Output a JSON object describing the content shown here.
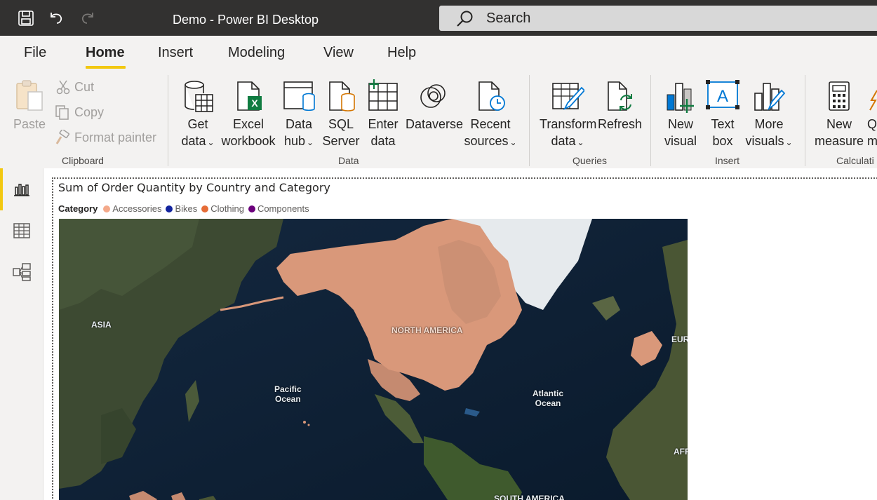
{
  "app": {
    "title": "Demo - Power BI Desktop"
  },
  "search": {
    "placeholder": "Search"
  },
  "tabs": [
    "File",
    "Home",
    "Insert",
    "Modeling",
    "View",
    "Help"
  ],
  "ribbon": {
    "clipboard": {
      "paste": "Paste",
      "cut": "Cut",
      "copy": "Copy",
      "format_painter": "Format painter",
      "label": "Clipboard"
    },
    "data": {
      "get_data": [
        "Get",
        "data"
      ],
      "excel_workbook": [
        "Excel",
        "workbook"
      ],
      "data_hub": [
        "Data",
        "hub"
      ],
      "sql_server": [
        "SQL",
        "Server"
      ],
      "enter_data": [
        "Enter",
        "data"
      ],
      "dataverse": "Dataverse",
      "recent_sources": [
        "Recent",
        "sources"
      ],
      "label": "Data"
    },
    "queries": {
      "transform_data": [
        "Transform",
        "data"
      ],
      "refresh": "Refresh",
      "label": "Queries"
    },
    "insert": {
      "new_visual": [
        "New",
        "visual"
      ],
      "text_box": [
        "Text",
        "box"
      ],
      "more_visuals": [
        "More",
        "visuals"
      ],
      "label": "Insert"
    },
    "calculations": {
      "new_measure": [
        "New",
        "measure"
      ],
      "quick_measure_partial": [
        "Q",
        "m"
      ],
      "label": "Calculati"
    }
  },
  "visual": {
    "title": "Sum of Order Quantity by Country and Category",
    "legend": {
      "title": "Category",
      "items": [
        {
          "name": "Accessories",
          "color": "#f4a98a"
        },
        {
          "name": "Bikes",
          "color": "#12239e"
        },
        {
          "name": "Clothing",
          "color": "#e66c37"
        },
        {
          "name": "Components",
          "color": "#6b007b"
        }
      ]
    },
    "map_labels": {
      "asia": "ASIA",
      "north_america": "NORTH AMERICA",
      "pacific": [
        "Pacific",
        "Ocean"
      ],
      "atlantic": [
        "Atlantic",
        "Ocean"
      ],
      "europe": "EUR",
      "africa": "AFR",
      "south_america": "SOUTH AMERICA"
    }
  },
  "colors": {
    "accent": "#f2c811",
    "titlebar": "#323130",
    "filled_country": "#d9987a"
  }
}
